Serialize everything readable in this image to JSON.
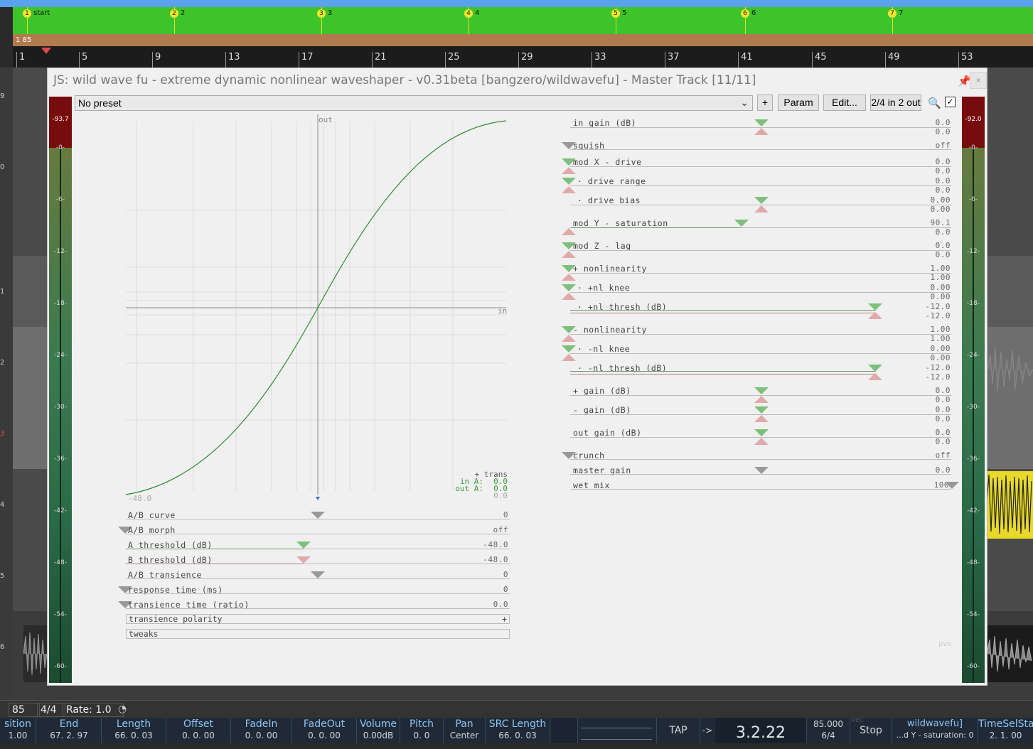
{
  "markers": [
    {
      "num": "1",
      "name": "start"
    },
    {
      "num": "2",
      "name": "2"
    },
    {
      "num": "3",
      "name": "3"
    },
    {
      "num": "4",
      "name": "4"
    },
    {
      "num": "5",
      "name": "5"
    },
    {
      "num": "6",
      "name": "6"
    },
    {
      "num": "7",
      "name": "7"
    }
  ],
  "tempo_lane": "1  85",
  "ruler": [
    "1",
    "5",
    "9",
    "13",
    "17",
    "21",
    "25",
    "29",
    "33",
    "37",
    "41",
    "45",
    "49",
    "53"
  ],
  "left_numbers": [
    "9",
    "0",
    "1",
    "2",
    "3",
    "4",
    "5",
    "6"
  ],
  "plugin": {
    "title": "JS: wild wave fu - extreme dynamic nonlinear waveshaper - v0.31beta [bangzero/wildwavefu] - Master Track [11/11]",
    "close_label": "×",
    "preset": "No preset",
    "buttons": {
      "plus": "+",
      "param": "Param",
      "edit": "Edit...",
      "io": "2/4 in 2 out"
    },
    "enabled_mark": "✓",
    "meter_left_peak": "-93.7",
    "meter_right_peak": "-92.0",
    "meter_scale": [
      "-0-",
      "-6-",
      "-12-",
      "-18-",
      "-24-",
      "-30-",
      "-36-",
      "-42-",
      "-48-",
      "-54-",
      "-60-"
    ],
    "graph": {
      "axis_out": "out",
      "axis_in": "in",
      "min_label": "-48.0",
      "trans_title": "+ trans",
      "in_label": "in A:",
      "in_value": "0.0",
      "out_label": "out A:",
      "out_value": "0.0",
      "extra_value": "0.0"
    },
    "left_sliders": [
      {
        "label": "A/B curve",
        "value": "0"
      },
      {
        "label": "A/B morph",
        "value": "off"
      },
      {
        "label": "A threshold (dB)",
        "value": "-48.0"
      },
      {
        "label": "B threshold (dB)",
        "value": "-48.0"
      },
      {
        "label": "A/B transience",
        "value": "0"
      },
      {
        "label": "response time (ms)",
        "value": "0"
      },
      {
        "label": "transience time (ratio)",
        "value": "0.0"
      },
      {
        "label": "transience polarity",
        "value": "+"
      },
      {
        "label": "tweaks",
        "value": ""
      }
    ],
    "right_sliders": [
      {
        "label": "in gain (dB)",
        "v1": "0.0",
        "v2": "0.0"
      },
      {
        "label": "squish",
        "v1": "off",
        "v2": ""
      },
      {
        "label": "mod X - drive",
        "v1": "0.0",
        "v2": "0.0"
      },
      {
        "label": "· drive range",
        "v1": "0.0",
        "v2": "0.0"
      },
      {
        "label": "· drive bias",
        "v1": "0.00",
        "v2": "0.00"
      },
      {
        "label": "mod Y - saturation",
        "v1": "90.1",
        "v2": "0.0"
      },
      {
        "label": "mod Z - lag",
        "v1": "0.0",
        "v2": "0.0"
      },
      {
        "label": "+ nonlinearity",
        "v1": "1.00",
        "v2": "1.00"
      },
      {
        "label": "· +nl knee",
        "v1": "0.00",
        "v2": "0.00"
      },
      {
        "label": "· +nl thresh (dB)",
        "v1": "-12.0",
        "v2": "-12.0"
      },
      {
        "label": "- nonlinearity",
        "v1": "1.00",
        "v2": "1.00"
      },
      {
        "label": "· -nl knee",
        "v1": "0.00",
        "v2": "0.00"
      },
      {
        "label": "· -nl thresh (dB)",
        "v1": "-12.0",
        "v2": "-12.0"
      },
      {
        "label": "+ gain (dB)",
        "v1": "0.0",
        "v2": "0.0"
      },
      {
        "label": "- gain (dB)",
        "v1": "0.0",
        "v2": "0.0"
      },
      {
        "label": "out gain (dB)",
        "v1": "0.0",
        "v2": "0.0"
      },
      {
        "label": "crunch",
        "v1": "off",
        "v2": ""
      },
      {
        "label": "master gain",
        "v1": "0.0",
        "v2": ""
      },
      {
        "label": "wet mix",
        "v1": "100",
        "v2": ""
      }
    ],
    "brand": "pvo"
  },
  "transport": {
    "tempo": "85",
    "timesig": "4/4",
    "rate": "Rate: 1.0"
  },
  "infobar": [
    {
      "h": "sition",
      "v": "1.00"
    },
    {
      "h": "End",
      "v": "67. 2. 97"
    },
    {
      "h": "Length",
      "v": "66. 0. 03"
    },
    {
      "h": "Offset",
      "v": "0. 0. 00"
    },
    {
      "h": "FadeIn",
      "v": "0. 0. 00"
    },
    {
      "h": "FadeOut",
      "v": "0. 0. 00"
    },
    {
      "h": "Volume",
      "v": "0.00dB"
    },
    {
      "h": "Pitch",
      "v": "0. 0"
    },
    {
      "h": "Pan",
      "v": "Center"
    },
    {
      "h": "SRC Length",
      "v": "66. 0. 03"
    }
  ],
  "tap": "TAP",
  "arrow": "->",
  "position": "3.2.22",
  "bpm": "85.000",
  "bpm_sig": "6/4",
  "stop": "Stop",
  "rec_label": "REC",
  "plugin_name": "wildwavefu]",
  "plugin_param": "...d Y - saturation: 0",
  "timesel_h": "TimeSelSta",
  "timesel_v": "2. 1. 00",
  "colors": {
    "marker": "#f3e62c",
    "markerlane": "#3dc42a",
    "curve": "#2f8a2f",
    "meter_peak": "#770c0c"
  }
}
